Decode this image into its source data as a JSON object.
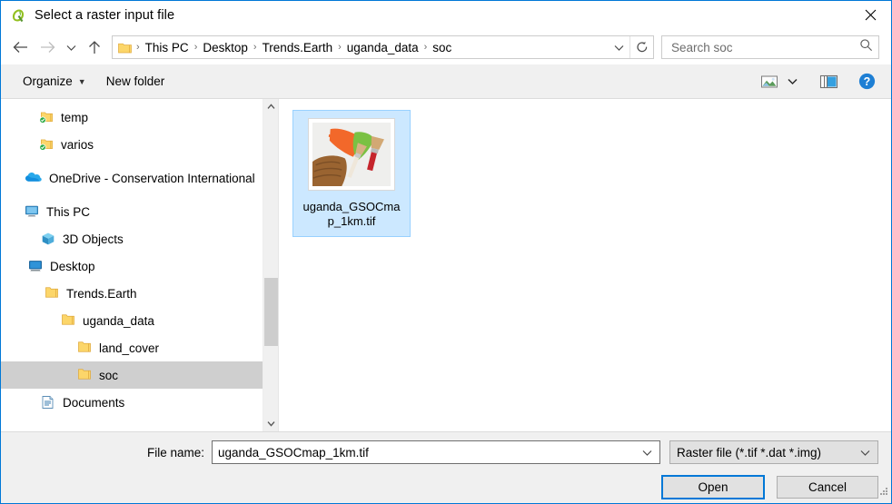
{
  "window": {
    "title": "Select a raster input file",
    "app_icon": "qgis-icon",
    "close_label": "×",
    "accent_color": "#0078d7"
  },
  "address_bar": {
    "back_icon": "back-arrow-icon",
    "forward_icon": "forward-arrow-icon",
    "recent_icon": "chevron-down-icon",
    "up_icon": "up-arrow-icon",
    "folder_icon": "folder-icon",
    "crumbs": [
      "This PC",
      "Desktop",
      "Trends.Earth",
      "uganda_data",
      "soc"
    ],
    "separator": "›",
    "dropdown_icon": "chevron-down-icon",
    "refresh_icon": "refresh-icon"
  },
  "search": {
    "placeholder": "Search soc",
    "icon": "search-icon"
  },
  "command_bar": {
    "organize_label": "Organize",
    "organize_caret": "▼",
    "new_folder_label": "New folder",
    "view_icon": "change-view-icon",
    "view_caret": "▼",
    "preview_icon": "preview-pane-icon",
    "help_icon": "help-icon",
    "help_label": "?"
  },
  "tree": {
    "items": [
      {
        "label": "temp",
        "icon": "folder-synced-icon",
        "indent": 2,
        "selected": false
      },
      {
        "label": "varios",
        "icon": "folder-synced-icon",
        "indent": 2,
        "selected": false
      },
      {
        "label": "OneDrive - Conservation International",
        "icon": "onedrive-icon",
        "indent": 1,
        "selected": false
      },
      {
        "label": "This PC",
        "icon": "this-pc-icon",
        "indent": 1,
        "selected": false
      },
      {
        "label": "3D Objects",
        "icon": "3d-objects-icon",
        "indent": 2,
        "selected": false
      },
      {
        "label": "Desktop",
        "icon": "desktop-icon",
        "indent": 2,
        "selected": false
      },
      {
        "label": "Trends.Earth",
        "icon": "folder-icon",
        "indent": 3,
        "selected": false
      },
      {
        "label": "uganda_data",
        "icon": "folder-icon",
        "indent": 4,
        "selected": false
      },
      {
        "label": "land_cover",
        "icon": "folder-icon",
        "indent": 5,
        "selected": false
      },
      {
        "label": "soc",
        "icon": "folder-icon",
        "indent": 5,
        "selected": true
      },
      {
        "label": "Documents",
        "icon": "documents-icon",
        "indent": 2,
        "selected": false
      }
    ],
    "scroll_up_icon": "chevron-up-icon",
    "scroll_down_icon": "chevron-down-icon"
  },
  "files": [
    {
      "name": "uganda_GSOCmap_1km.tif",
      "thumbnail": "paint-image-thumbnail",
      "selected": true
    }
  ],
  "footer": {
    "file_name_label": "File name:",
    "file_name_value": "uganda_GSOCmap_1km.tif",
    "file_name_caret": "chevron-down-icon",
    "file_type_value": "Raster file (*.tif *.dat *.img)",
    "file_type_caret": "chevron-down-icon",
    "open_label": "Open",
    "cancel_label": "Cancel",
    "resize_grip": "resize-grip-icon"
  }
}
